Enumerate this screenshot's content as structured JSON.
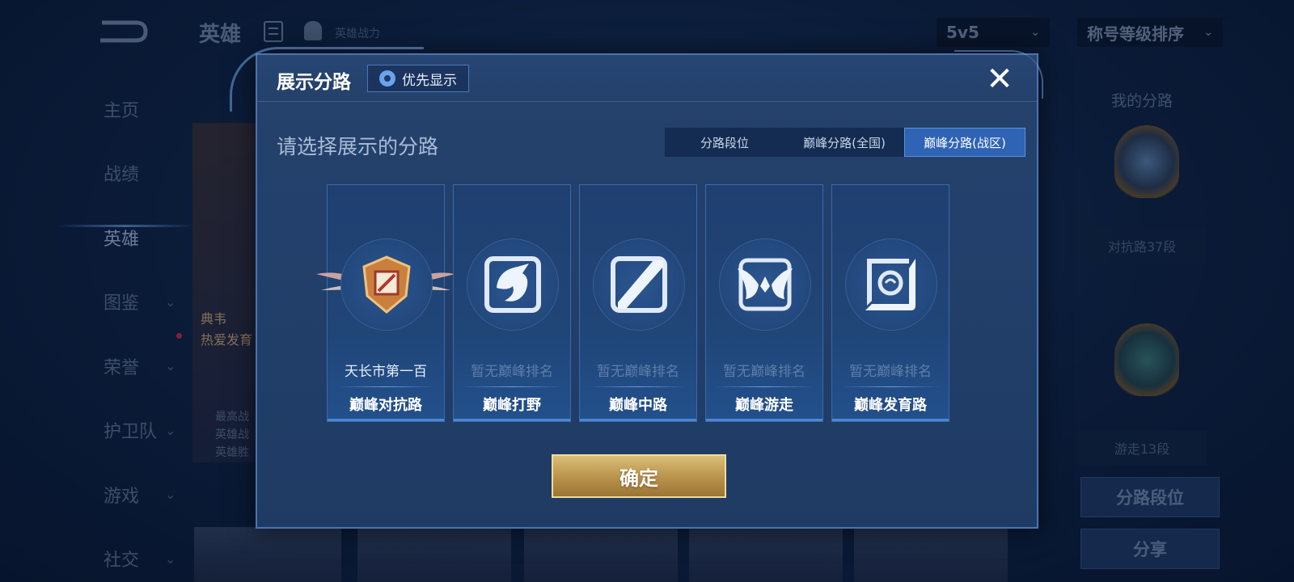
{
  "background": {
    "title": "英雄",
    "power_label": "英雄战力",
    "mode_select": "5v5",
    "sort_select": "称号等级排序",
    "sidebar": [
      {
        "label": "主页",
        "has_caret": false
      },
      {
        "label": "战绩",
        "has_caret": false
      },
      {
        "label": "英雄",
        "has_caret": false,
        "active": true
      },
      {
        "label": "图鉴",
        "has_caret": true
      },
      {
        "label": "荣誉",
        "has_caret": true
      },
      {
        "label": "护卫队",
        "has_caret": true
      },
      {
        "label": "游戏",
        "has_caret": true
      },
      {
        "label": "社交",
        "has_caret": true
      }
    ],
    "hero_card_lines": [
      "典韦",
      "热爱发育"
    ],
    "hero_card_sub": [
      "最高战",
      "英雄战",
      "英雄胜"
    ],
    "right_panel": {
      "title": "我的分路",
      "rank1": "对抗路37段",
      "rank2": "游走13段",
      "btn_lane": "分路段位",
      "btn_share": "分享"
    }
  },
  "modal": {
    "title": "展示分路",
    "priority_button": "优先显示",
    "prompt": "请选择展示的分路",
    "tabs": [
      "分路段位",
      "巅峰分路(全国)",
      "巅峰分路(战区)"
    ],
    "active_tab": 2,
    "lanes": [
      {
        "name": "巅峰对抗路",
        "rank": "天长市第一百",
        "icon": "badge-icon",
        "has_rank": true
      },
      {
        "name": "巅峰打野",
        "rank": "暂无巅峰排名",
        "icon": "dragon-icon",
        "has_rank": false
      },
      {
        "name": "巅峰中路",
        "rank": "暂无巅峰排名",
        "icon": "slash-icon",
        "has_rank": false
      },
      {
        "name": "巅峰游走",
        "rank": "暂无巅峰排名",
        "icon": "wings-icon",
        "has_rank": false
      },
      {
        "name": "巅峰发育路",
        "rank": "暂无巅峰排名",
        "icon": "target-icon",
        "has_rank": false
      }
    ],
    "confirm": "确定"
  },
  "colors": {
    "accent_blue": "#2f63b4",
    "gold": "#c8a45c",
    "panel": "#22406b"
  }
}
